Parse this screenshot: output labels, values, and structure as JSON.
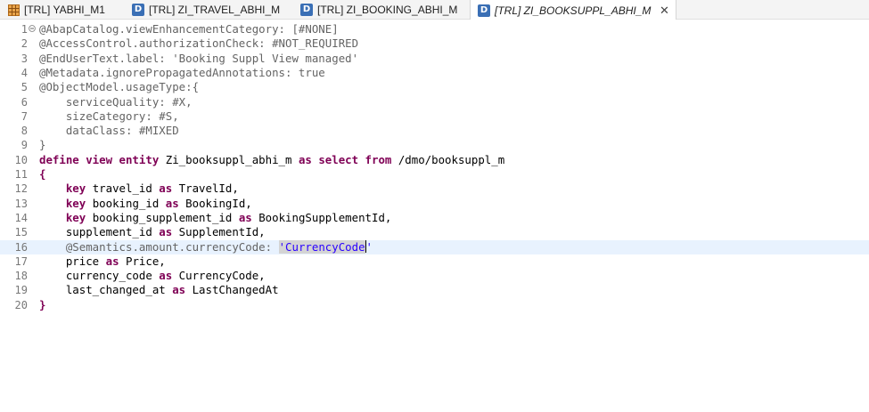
{
  "tabs": [
    {
      "label": "[TRL] YABHI_M1",
      "icon": "table-icon",
      "active": false
    },
    {
      "label": "[TRL] ZI_TRAVEL_ABHI_M",
      "icon": "ddl-source-icon",
      "active": false
    },
    {
      "label": "[TRL] ZI_BOOKING_ABHI_M",
      "icon": "ddl-source-icon",
      "active": false
    },
    {
      "label": "[TRL] ZI_BOOKSUPPL_ABHI_M",
      "icon": "ddl-source-icon",
      "active": true
    }
  ],
  "icon_letters": {
    "ddl": "D"
  },
  "close_glyph": "✕",
  "code": {
    "current_line": 16,
    "lines": [
      {
        "n": "1",
        "segments": [
          {
            "t": "@AbapCatalog.viewEnhancementCategory: [#NONE]",
            "c": "ann"
          }
        ]
      },
      {
        "n": "2",
        "segments": [
          {
            "t": "@AccessControl.authorizationCheck: #NOT_REQUIRED",
            "c": "ann"
          }
        ]
      },
      {
        "n": "3",
        "segments": [
          {
            "t": "@EndUserText.label: 'Booking Suppl View managed'",
            "c": "ann"
          }
        ]
      },
      {
        "n": "4",
        "segments": [
          {
            "t": "@Metadata.ignorePropagatedAnnotations: true",
            "c": "ann"
          }
        ]
      },
      {
        "n": "5",
        "segments": [
          {
            "t": "@ObjectModel.usageType:{",
            "c": "ann"
          }
        ]
      },
      {
        "n": "6",
        "segments": [
          {
            "t": "    serviceQuality: #X,",
            "c": "ann"
          }
        ]
      },
      {
        "n": "7",
        "segments": [
          {
            "t": "    sizeCategory: #S,",
            "c": "ann"
          }
        ]
      },
      {
        "n": "8",
        "segments": [
          {
            "t": "    dataClass: #MIXED",
            "c": "ann"
          }
        ]
      },
      {
        "n": "9",
        "segments": [
          {
            "t": "}",
            "c": "ann"
          }
        ]
      },
      {
        "n": "10",
        "segments": [
          {
            "t": "define view entity",
            "c": "kw"
          },
          {
            "t": " Zi_booksuppl_abhi_m ",
            "c": ""
          },
          {
            "t": "as select from",
            "c": "kw"
          },
          {
            "t": " /dmo/booksuppl_m",
            "c": ""
          }
        ]
      },
      {
        "n": "11",
        "segments": [
          {
            "t": "{",
            "c": "kw"
          }
        ]
      },
      {
        "n": "12",
        "segments": [
          {
            "t": "    ",
            "c": ""
          },
          {
            "t": "key",
            "c": "kw"
          },
          {
            "t": " travel_id ",
            "c": ""
          },
          {
            "t": "as",
            "c": "kw"
          },
          {
            "t": " TravelId,",
            "c": ""
          }
        ]
      },
      {
        "n": "13",
        "segments": [
          {
            "t": "    ",
            "c": ""
          },
          {
            "t": "key",
            "c": "kw"
          },
          {
            "t": " booking_id ",
            "c": ""
          },
          {
            "t": "as",
            "c": "kw"
          },
          {
            "t": " BookingId,",
            "c": ""
          }
        ]
      },
      {
        "n": "14",
        "segments": [
          {
            "t": "    ",
            "c": ""
          },
          {
            "t": "key",
            "c": "kw"
          },
          {
            "t": " booking_supplement_id ",
            "c": ""
          },
          {
            "t": "as",
            "c": "kw"
          },
          {
            "t": " BookingSupplementId,",
            "c": ""
          }
        ]
      },
      {
        "n": "15",
        "segments": [
          {
            "t": "    supplement_id ",
            "c": ""
          },
          {
            "t": "as",
            "c": "kw"
          },
          {
            "t": " SupplementId,",
            "c": ""
          }
        ]
      },
      {
        "n": "16",
        "segments": [
          {
            "t": "    ",
            "c": ""
          },
          {
            "t": "@Semantics.amount.currencyCode: ",
            "c": "ann"
          },
          {
            "t": "'CurrencyCode",
            "c": "str sel"
          },
          {
            "t": "",
            "c": "caret"
          },
          {
            "t": "'",
            "c": "str"
          }
        ]
      },
      {
        "n": "17",
        "segments": [
          {
            "t": "    price ",
            "c": ""
          },
          {
            "t": "as",
            "c": "kw"
          },
          {
            "t": " Price,",
            "c": ""
          }
        ]
      },
      {
        "n": "18",
        "segments": [
          {
            "t": "    currency_code ",
            "c": ""
          },
          {
            "t": "as",
            "c": "kw"
          },
          {
            "t": " CurrencyCode,",
            "c": ""
          }
        ]
      },
      {
        "n": "19",
        "segments": [
          {
            "t": "    last_changed_at ",
            "c": ""
          },
          {
            "t": "as",
            "c": "kw"
          },
          {
            "t": " LastChangedAt",
            "c": ""
          }
        ]
      },
      {
        "n": "20",
        "segments": [
          {
            "t": "}",
            "c": "kw"
          }
        ]
      }
    ]
  }
}
